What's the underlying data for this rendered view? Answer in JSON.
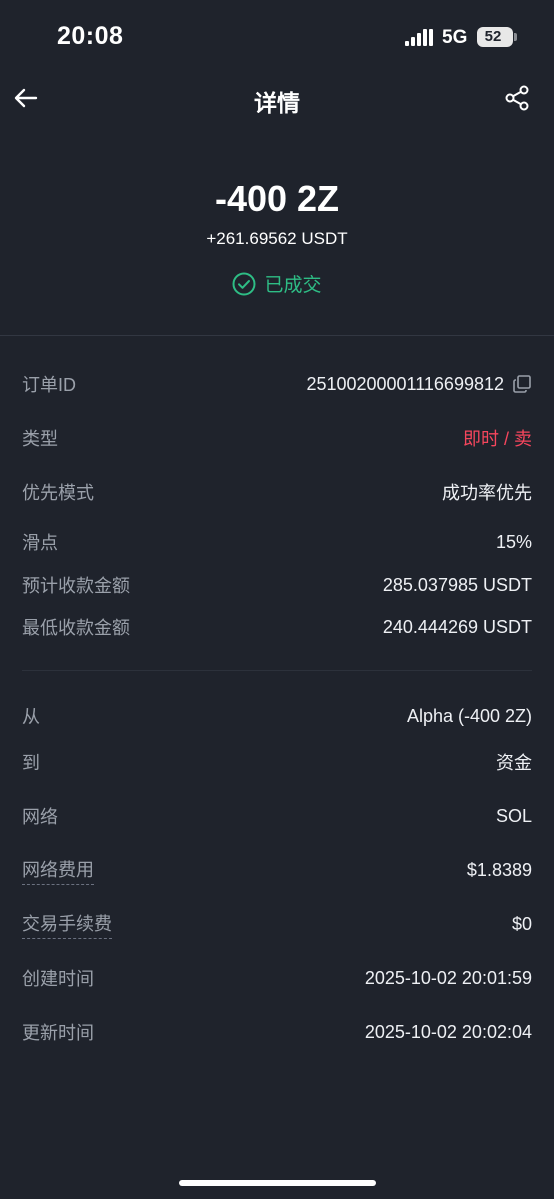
{
  "status_bar": {
    "time": "20:08",
    "network": "5G",
    "battery": "52"
  },
  "header": {
    "title": "详情"
  },
  "summary": {
    "amount": "-400 2Z",
    "sub_amount": "+261.69562 USDT",
    "status": "已成交"
  },
  "details": [
    {
      "label": "订单ID",
      "value": "2510020000111669981​2"
    },
    {
      "label": "类型",
      "value": "即时 / 卖"
    },
    {
      "label": "优先模式",
      "value": "成功率优先"
    },
    {
      "label": "滑点",
      "value": "15%"
    },
    {
      "label": "预计收款金额",
      "value": "285.037985 USDT"
    },
    {
      "label": "最低收款金额",
      "value": "240.444269 USDT"
    }
  ],
  "transfer": [
    {
      "label": "从",
      "value": "Alpha (-400 2Z)"
    },
    {
      "label": "到",
      "value": "资金"
    },
    {
      "label": "网络",
      "value": "SOL"
    },
    {
      "label": "网络费用",
      "value": "$1.8389"
    },
    {
      "label": "交易手续费",
      "value": "$0"
    },
    {
      "label": "创建时间",
      "value": "2025-10-02 20:01:59"
    },
    {
      "label": "更新时间",
      "value": "2025-10-02 20:02:04"
    }
  ],
  "colors": {
    "background": "#1f232c",
    "success": "#2ebd85",
    "sell": "#f6465d"
  }
}
